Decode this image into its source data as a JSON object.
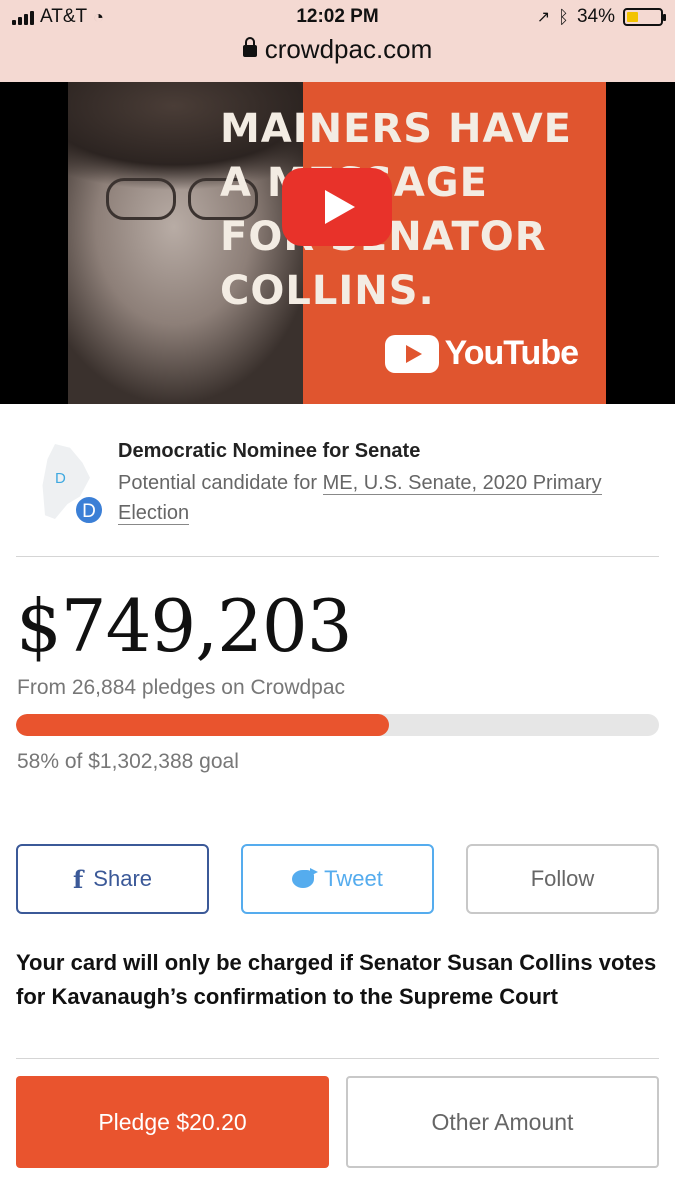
{
  "status_bar": {
    "carrier": "AT&T",
    "time": "12:02 PM",
    "battery": "34%",
    "battery_level": 0.34
  },
  "browser": {
    "url": "crowdpac.com"
  },
  "video": {
    "headline": "MAINERS HAVE\nA MESSAGE\nFOR SENATOR\nCOLLINS.",
    "brand": "YouTube"
  },
  "candidate": {
    "map_letter": "D",
    "party_badge": "D",
    "title": "Democratic Nominee for Senate",
    "potential_prefix": "Potential candidate for ",
    "race_link": "ME, U.S. Senate, 2020 Primary Election"
  },
  "funding": {
    "amount": "$749,203",
    "pledges_text": "From 26,884 pledges on Crowdpac",
    "progress_percent": 58,
    "goal_text": "58% of $1,302,388 goal"
  },
  "social": {
    "share_label": "Share",
    "share_icon": "f",
    "tweet_label": "Tweet",
    "follow_label": "Follow"
  },
  "note": "Your card will only be charged if Senator Susan Collins votes for Kavanaugh’s confirmation to the Supreme Court",
  "actions": {
    "pledge_label": "Pledge $20.20",
    "other_label": "Other Amount"
  },
  "colors": {
    "accent": "#e9542e",
    "facebook": "#3b5998",
    "twitter": "#55acee",
    "party_blue": "#3b7fd6"
  }
}
